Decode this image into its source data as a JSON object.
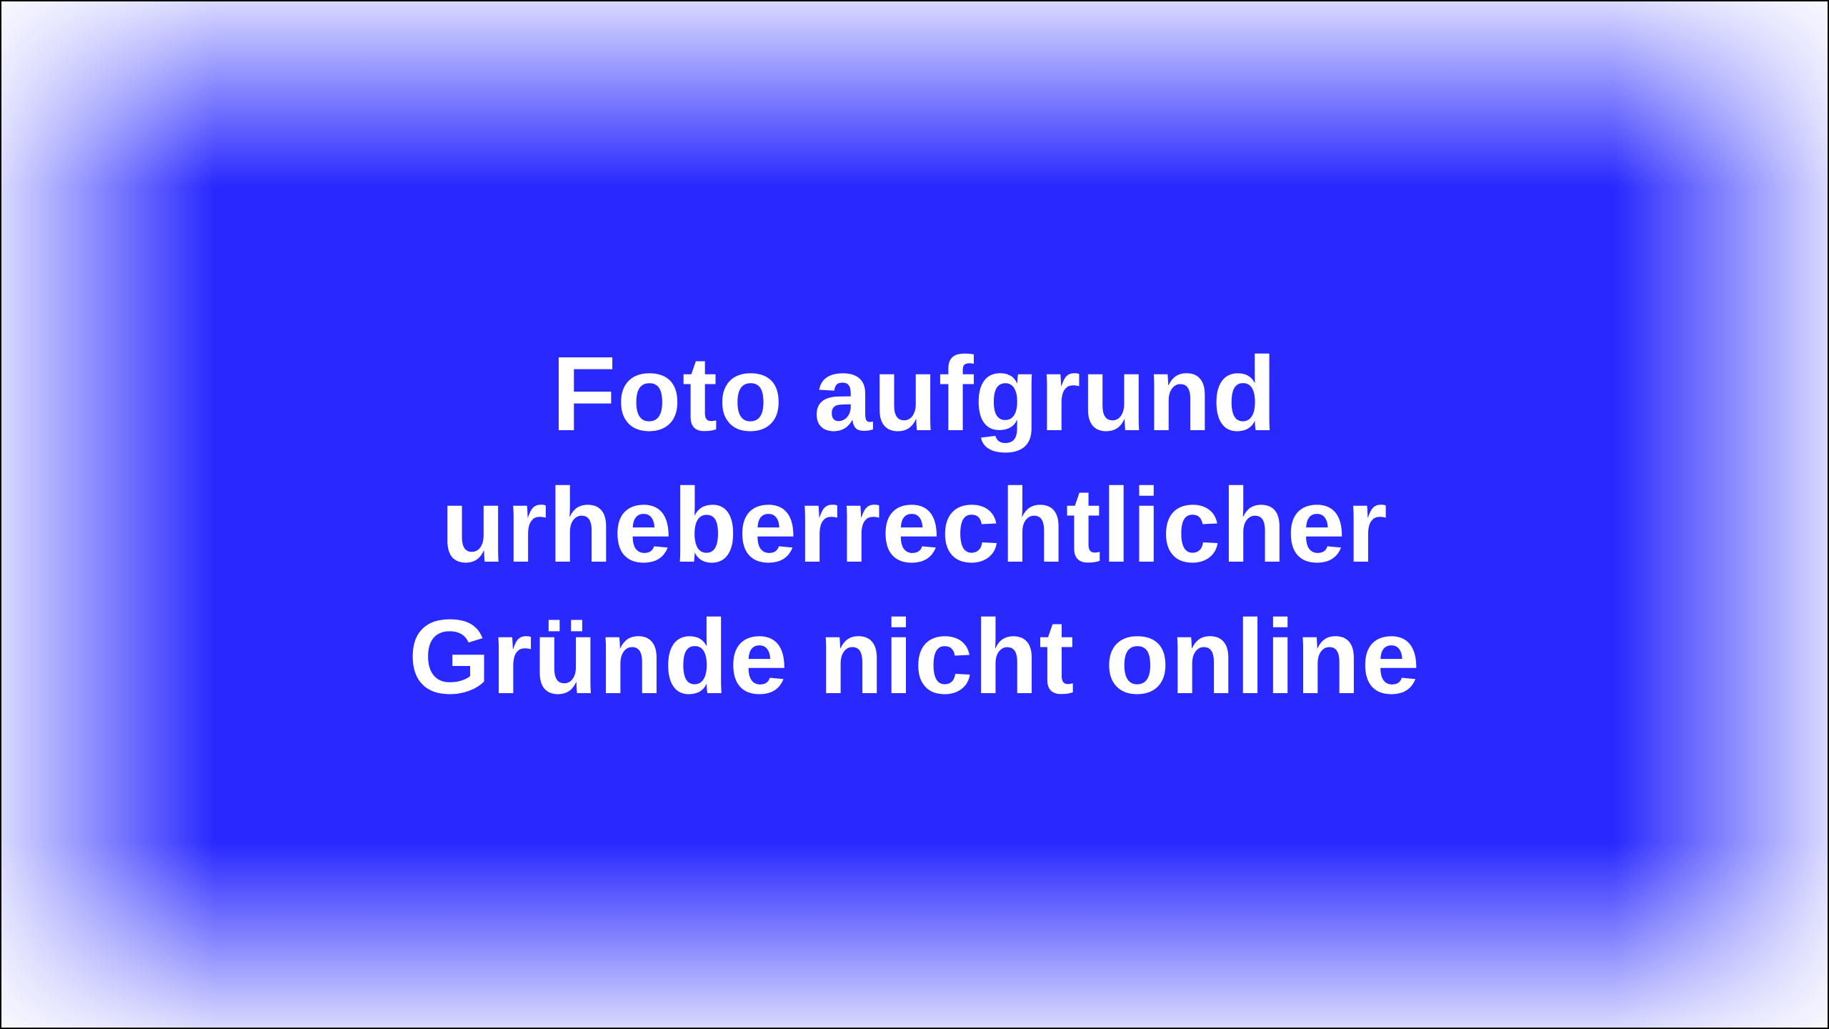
{
  "placeholder": {
    "lines": [
      "Foto aufgrund",
      "urheberrechtlicher",
      "Gründe nicht online"
    ]
  },
  "colors": {
    "background": "#2828ff",
    "text": "#ffffff",
    "border": "#000000"
  }
}
